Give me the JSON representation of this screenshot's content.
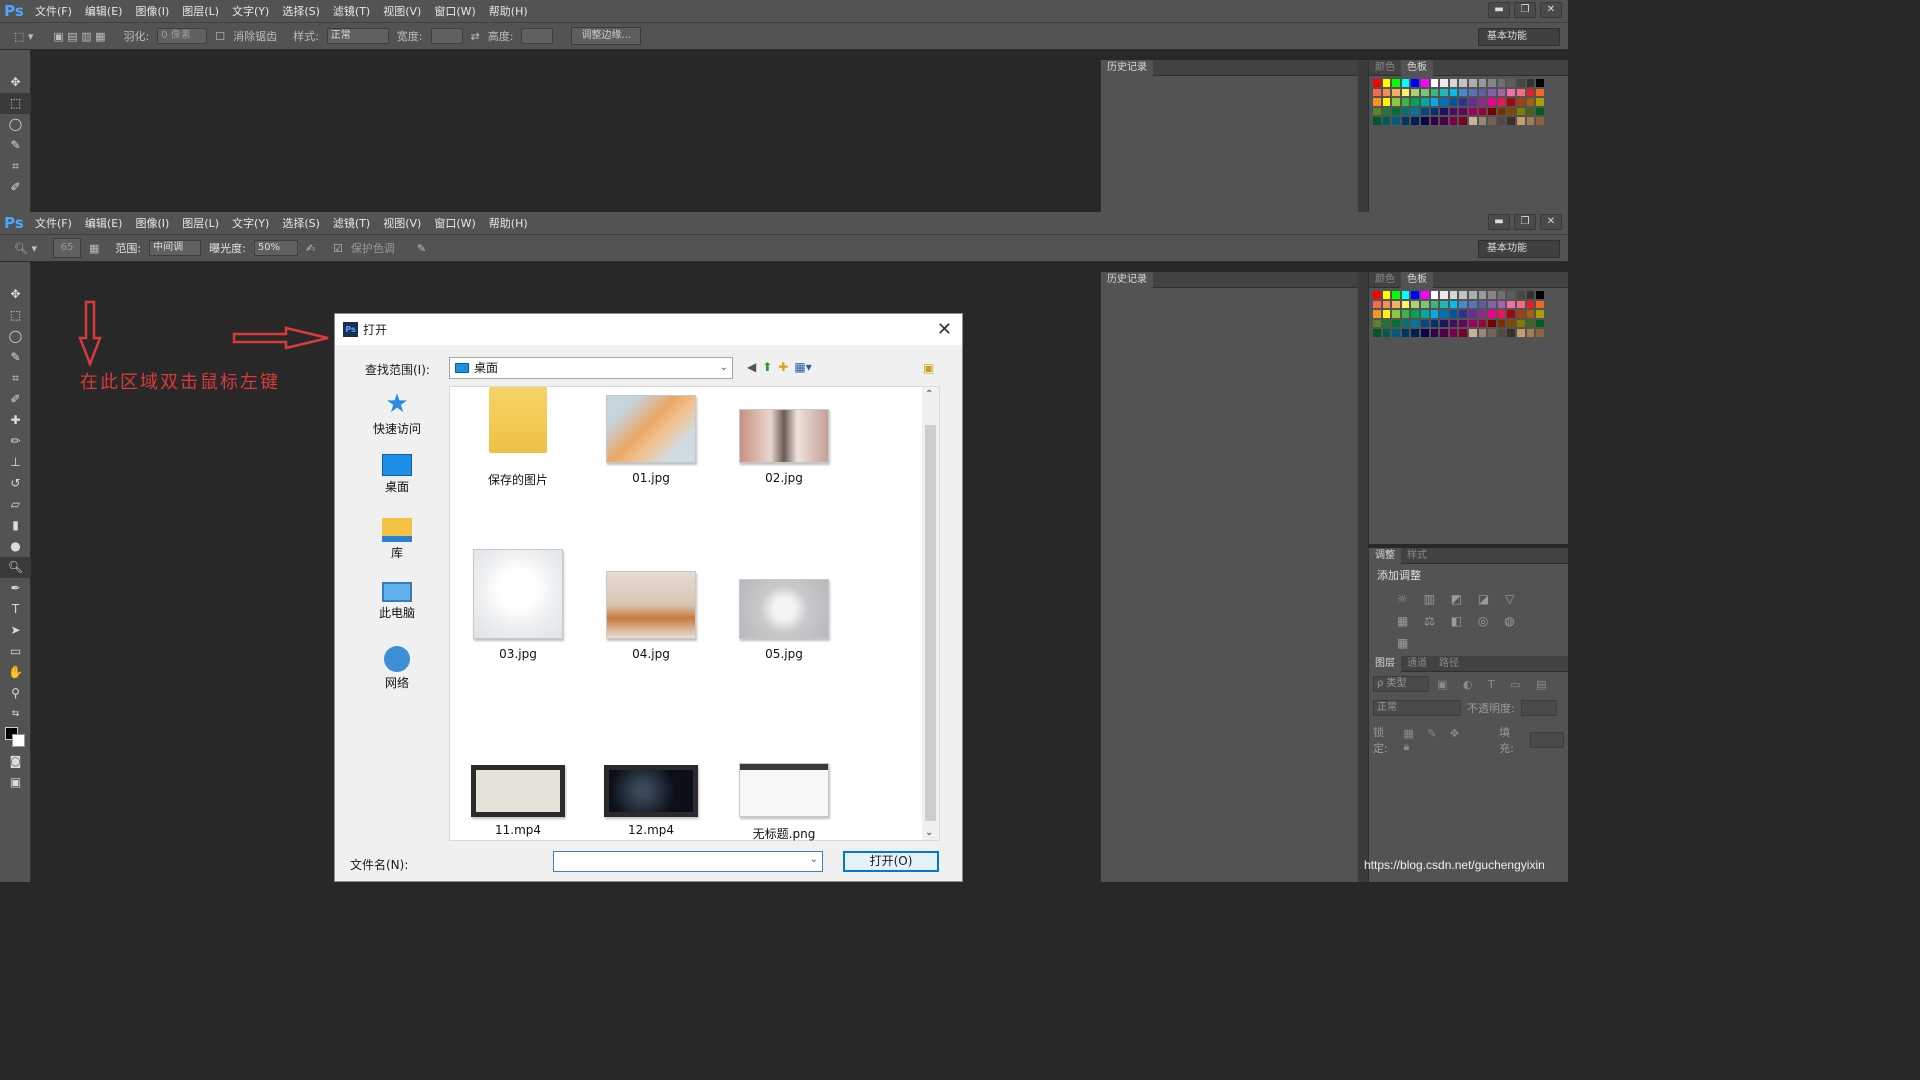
{
  "app": {
    "logo": "Ps",
    "menus": [
      "文件(F)",
      "编辑(E)",
      "图像(I)",
      "图层(L)",
      "文字(Y)",
      "选择(S)",
      "滤镜(T)",
      "视图(V)",
      "窗口(W)",
      "帮助(H)"
    ],
    "window_controls": [
      "▬",
      "❐",
      "✕"
    ],
    "workspace": "基本功能"
  },
  "top_options": {
    "feather_label": "羽化:",
    "feather_value": "0 像素",
    "antialias_label": "消除锯齿",
    "style_label": "样式:",
    "style_value": "正常",
    "width_label": "宽度:",
    "height_label": "高度:",
    "refine_button": "调整边缘..."
  },
  "bottom_options": {
    "brush_size": "65",
    "range_label": "范围:",
    "range_value": "中间调",
    "exposure_label": "曝光度:",
    "exposure_value": "50%",
    "protect_tones": "保护色调"
  },
  "panels": {
    "history": "历史记录",
    "color_tab": "颜色",
    "swatches_tab": "色板",
    "adjust_tab": "调整",
    "styles_tab": "样式",
    "add_adjust": "添加调整",
    "layers_tab": "图层",
    "channels_tab": "通道",
    "paths_tab": "路径",
    "kind_filter": "ρ 类型",
    "blend_mode": "正常",
    "opacity_label": "不透明度:",
    "lock_label": "锁定:",
    "fill_label": "填充:"
  },
  "swatch_colors": [
    "#ff0000",
    "#ffff00",
    "#00ff00",
    "#00ffff",
    "#0000ff",
    "#ff00ff",
    "#ffffff",
    "#ebebeb",
    "#d6d6d6",
    "#c2c2c2",
    "#adadad",
    "#999999",
    "#858585",
    "#707070",
    "#5c5c5c",
    "#474747",
    "#333333",
    "#000000",
    "#f26c4f",
    "#f68e55",
    "#fbaf5c",
    "#fff467",
    "#acd372",
    "#7cc576",
    "#3bb878",
    "#1abbb4",
    "#00bff3",
    "#438ccb",
    "#5574b9",
    "#605ca8",
    "#855fa8",
    "#a763a8",
    "#f06ea9",
    "#f26d7d",
    "#ed1c24",
    "#f26522",
    "#f7941d",
    "#fff200",
    "#8dc73f",
    "#39b54a",
    "#00a651",
    "#00a99d",
    "#00aeef",
    "#0072bc",
    "#0054a6",
    "#2e3192",
    "#662d91",
    "#92278f",
    "#ec008c",
    "#ed145b",
    "#9e0b0f",
    "#a0410d",
    "#a36209",
    "#aba000",
    "#598527",
    "#197b30",
    "#007236",
    "#00746b",
    "#0076a3",
    "#004b80",
    "#003471",
    "#1b1464",
    "#440e62",
    "#630460",
    "#9e005d",
    "#9e0039",
    "#790000",
    "#7b2e00",
    "#7d4900",
    "#827b00",
    "#406618",
    "#005e20",
    "#005826",
    "#005952",
    "#005b7f",
    "#003663",
    "#002157",
    "#0d004c",
    "#32004b",
    "#4b0049",
    "#7b0046",
    "#7a0026",
    "#c7b299",
    "#998675",
    "#736357",
    "#534741",
    "#37302d",
    "#c69c6d",
    "#a67c52",
    "#8c6239"
  ],
  "annotation": "在此区域双击鼠标左键",
  "dialog": {
    "title": "打开",
    "close": "✕",
    "lookin_label": "查找范围(I):",
    "lookin_value": "桌面",
    "places": [
      "快速访问",
      "桌面",
      "库",
      "此电脑",
      "网络"
    ],
    "files": [
      "保存的图片",
      "01.jpg",
      "02.jpg",
      "03.jpg",
      "04.jpg",
      "05.jpg",
      "11.mp4",
      "12.mp4",
      "无标题.png"
    ],
    "filename_label": "文件名(N):",
    "filename_value": "",
    "open_button": "打开(O)"
  },
  "watermark": "https://blog.csdn.net/guchengyixin"
}
